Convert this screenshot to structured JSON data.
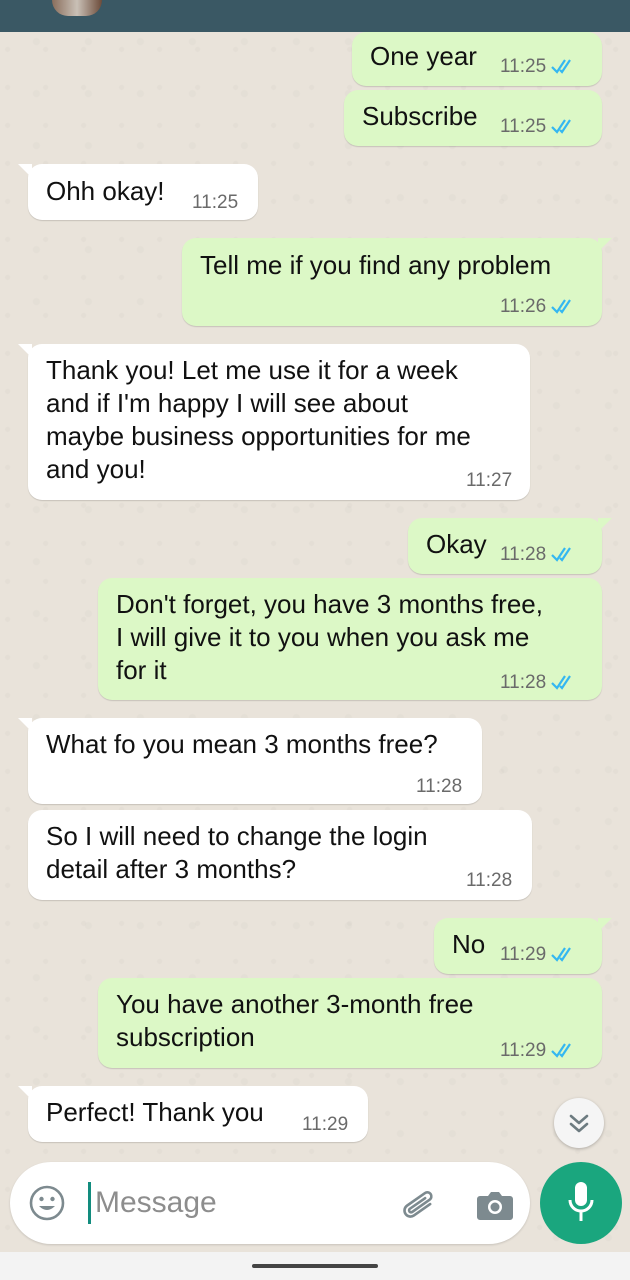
{
  "composer": {
    "placeholder": "Message"
  },
  "messages": [
    {
      "dir": "out",
      "text": "One year",
      "time": "11:25",
      "ticks": true
    },
    {
      "dir": "out",
      "text": "Subscribe",
      "time": "11:25",
      "ticks": true
    },
    {
      "dir": "in",
      "text": "Ohh okay!",
      "time": "11:25"
    },
    {
      "dir": "out",
      "text": "Tell me if you find any problem",
      "time": "11:26",
      "ticks": true
    },
    {
      "dir": "in",
      "text": "Thank you! Let me use it for a week\nand if I'm happy I will see about\nmaybe business opportunities for me\nand you!",
      "time": "11:27"
    },
    {
      "dir": "out",
      "text": "Okay",
      "time": "11:28",
      "ticks": true
    },
    {
      "dir": "out",
      "text": "Don't forget, you have 3 months free,\nI will give it to you when you ask me\nfor it",
      "time": "11:28",
      "ticks": true
    },
    {
      "dir": "in",
      "text": "What fo you mean 3 months free?",
      "time": "11:28"
    },
    {
      "dir": "in",
      "text": "So I will need to change the login\ndetail after 3 months?",
      "time": "11:28"
    },
    {
      "dir": "out",
      "text": "No",
      "time": "11:29",
      "ticks": true
    },
    {
      "dir": "out",
      "text": "You have another 3-month free\nsubscription",
      "time": "11:29",
      "ticks": true
    },
    {
      "dir": "in",
      "text": "Perfect! Thank you",
      "time": "11:29"
    }
  ],
  "colors": {
    "outgoing_bubble": "#dcf8c6",
    "incoming_bubble": "#ffffff",
    "read_ticks": "#34b7f1",
    "accent": "#1aa67e",
    "header": "#3a5864"
  },
  "icons": [
    "emoji-icon",
    "attach-icon",
    "camera-icon",
    "mic-icon",
    "double-chevron-down-icon",
    "read-receipt-icon"
  ]
}
